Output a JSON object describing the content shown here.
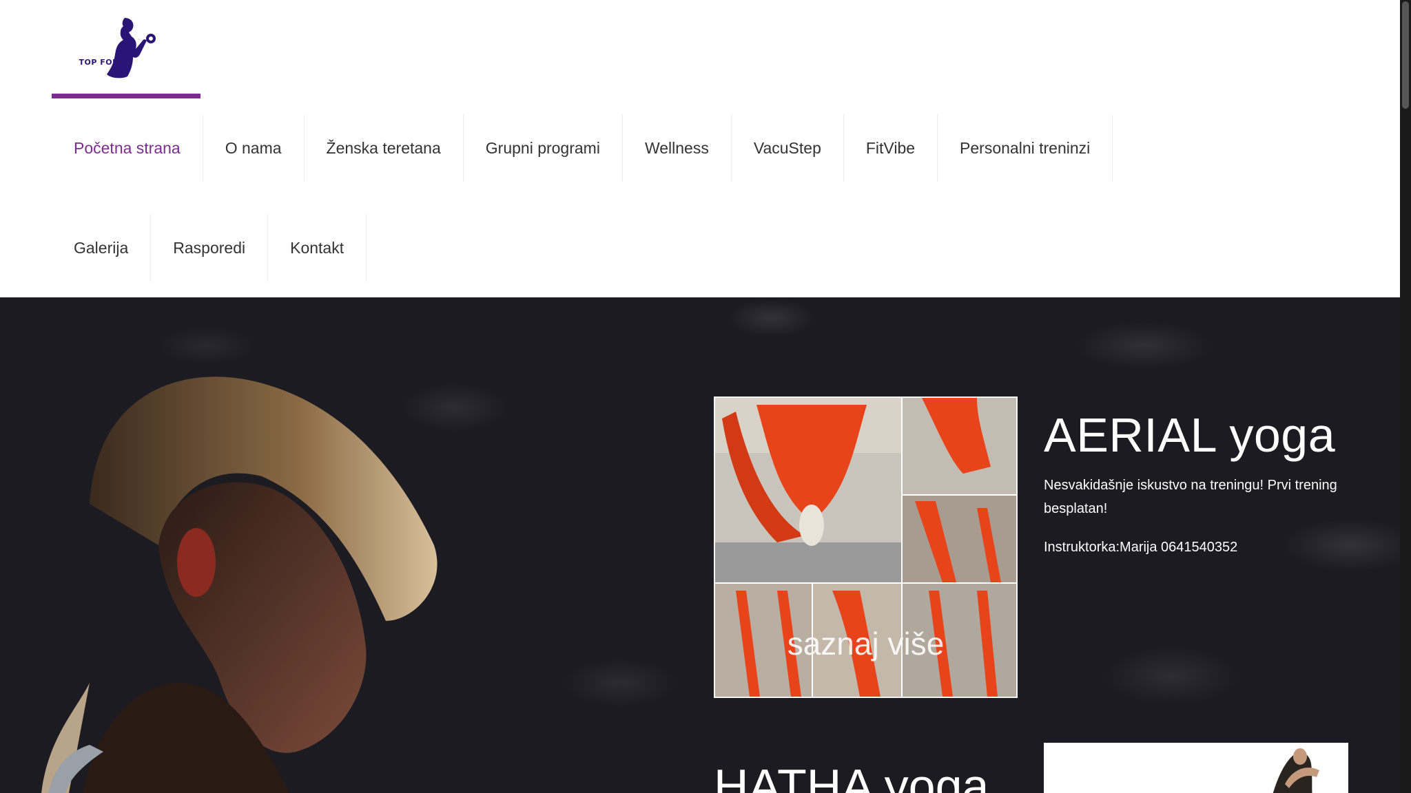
{
  "brand": {
    "logo_text": "TOP FORM",
    "accent_color": "#7b2d8e",
    "logo_color": "#2a1577"
  },
  "nav": {
    "row1": [
      "Početna strana",
      "O nama",
      "Ženska teretana",
      "Grupni programi",
      "Wellness",
      "VacuStep",
      "FitVibe",
      "Personalni treninzi"
    ],
    "row2": [
      "Galerija",
      "Rasporedi",
      "Kontakt"
    ],
    "active": "Početna strana"
  },
  "hero": {
    "aerial": {
      "title": "AERIAL yoga",
      "description": "Nesvakidašnje iskustvo na treningu! Prvi trening besplatan!",
      "instructor": "Instruktorka:Marija 0641540352",
      "overlay_link": "saznaj više"
    },
    "hatha": {
      "title": "HATHA yoga"
    }
  }
}
